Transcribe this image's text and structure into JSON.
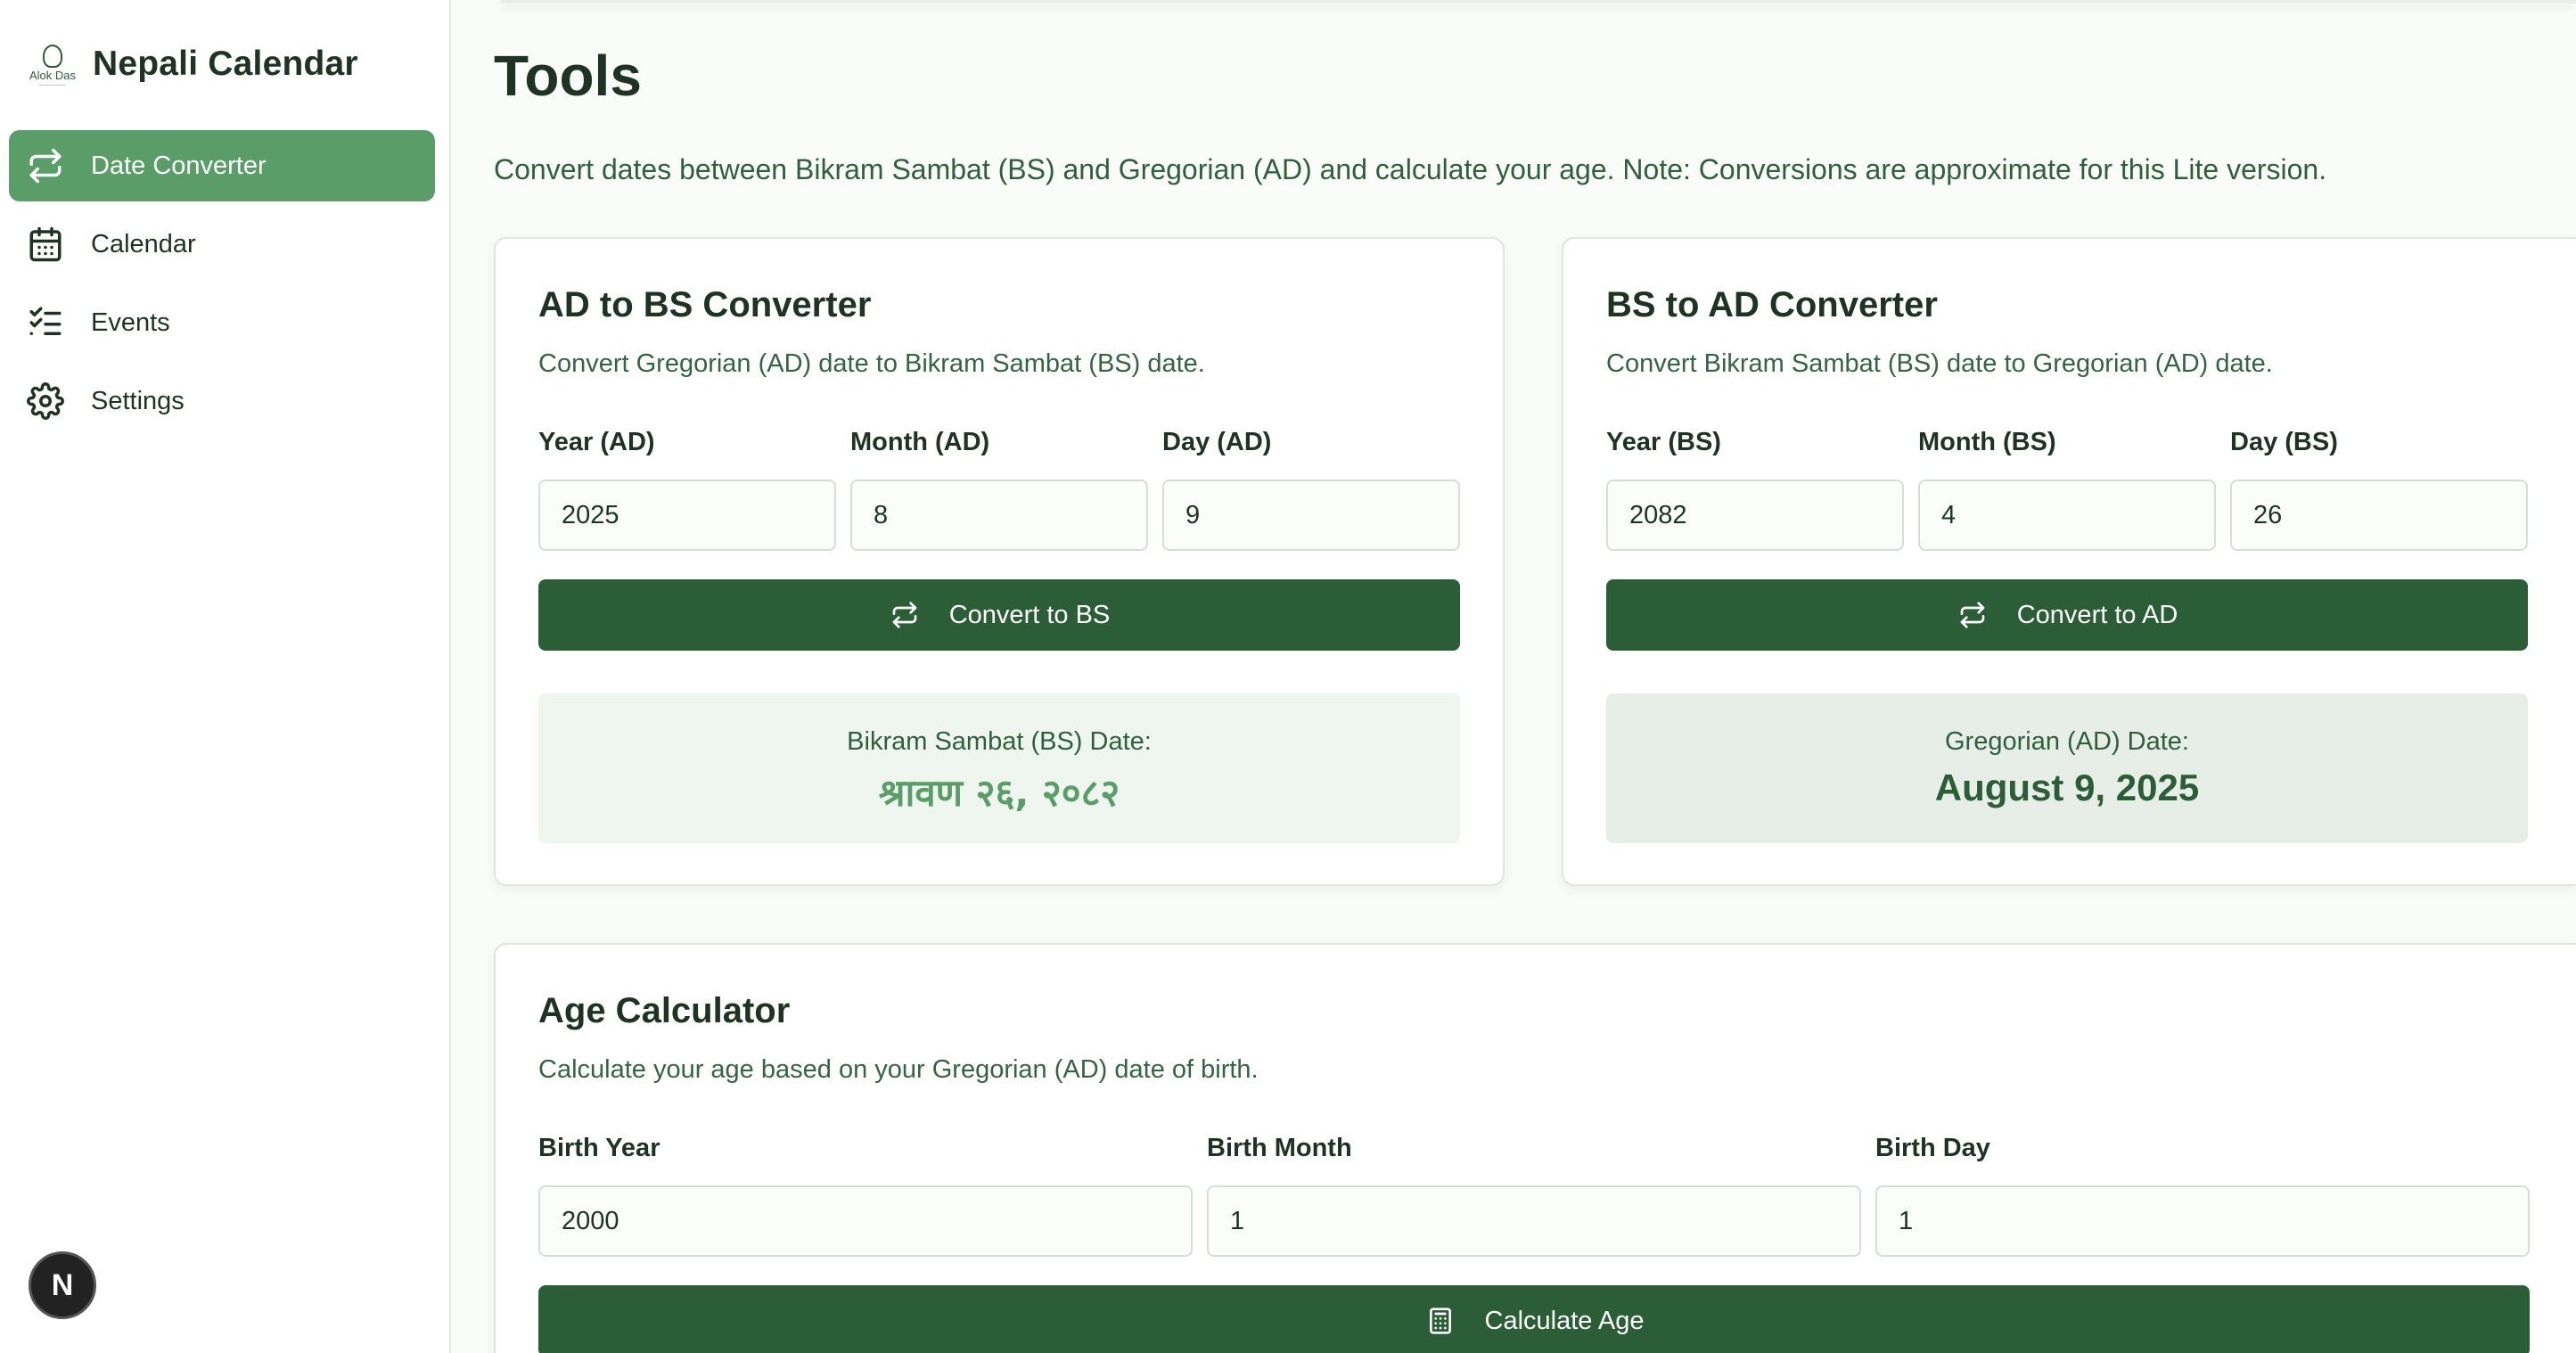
{
  "brand": {
    "logo_text": "Alok Das",
    "title": "Nepali Calendar"
  },
  "nav": [
    {
      "label": "Date Converter",
      "icon": "swap-icon",
      "active": true
    },
    {
      "label": "Calendar",
      "icon": "calendar-icon",
      "active": false
    },
    {
      "label": "Events",
      "icon": "list-check-icon",
      "active": false
    },
    {
      "label": "Settings",
      "icon": "gear-icon",
      "active": false
    }
  ],
  "fab_label": "N",
  "page": {
    "title": "Tools",
    "description": "Convert dates between Bikram Sambat (BS) and Gregorian (AD) and calculate your age. Note: Conversions are approximate for this Lite version."
  },
  "ad_to_bs": {
    "title": "AD to BS Converter",
    "subtitle": "Convert Gregorian (AD) date to Bikram Sambat (BS) date.",
    "year_label": "Year (AD)",
    "year_value": "2025",
    "month_label": "Month (AD)",
    "month_value": "8",
    "day_label": "Day (AD)",
    "day_value": "9",
    "button": "Convert to BS",
    "result_label": "Bikram Sambat (BS) Date:",
    "result_value": "श्रावण २६, २०८२"
  },
  "bs_to_ad": {
    "title": "BS to AD Converter",
    "subtitle": "Convert Bikram Sambat (BS) date to Gregorian (AD) date.",
    "year_label": "Year (BS)",
    "year_value": "2082",
    "month_label": "Month (BS)",
    "month_value": "4",
    "day_label": "Day (BS)",
    "day_value": "26",
    "button": "Convert to AD",
    "result_label": "Gregorian (AD) Date:",
    "result_value": "August 9, 2025"
  },
  "age_calc": {
    "title": "Age Calculator",
    "subtitle": "Calculate your age based on your Gregorian (AD) date of birth.",
    "year_label": "Birth Year",
    "year_value": "2000",
    "month_label": "Birth Month",
    "month_value": "1",
    "day_label": "Birth Day",
    "day_value": "1",
    "button": "Calculate Age"
  },
  "colors": {
    "accent": "#5a9d68",
    "button": "#2b5d36",
    "result_bs_bg": "#eef6ef",
    "result_ad_bg": "#e7eee8"
  }
}
